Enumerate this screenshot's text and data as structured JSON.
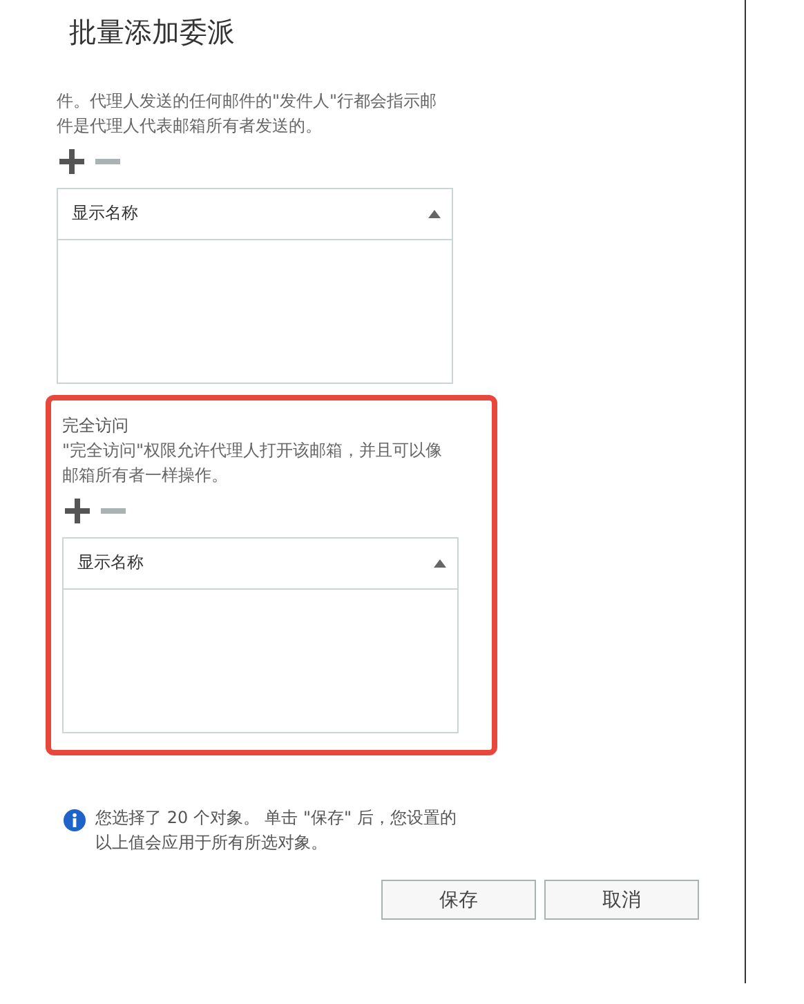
{
  "window": {
    "title": "批量添加委派"
  },
  "sections": [
    {
      "highlighted": false,
      "description": "件。代理人发送的任何邮件的\"发件人\"行都会指示邮件是代理人代表邮箱所有者发送的。",
      "tools": [
        {
          "kind": "add",
          "disabled": false
        },
        {
          "kind": "remove",
          "disabled": true
        }
      ],
      "table": {
        "columns": [
          "显示名称"
        ]
      }
    },
    {
      "highlighted": true,
      "label": "完全访问",
      "description": "\"完全访问\"权限允许代理人打开该邮箱，并且可以像邮箱所有者一样操作。",
      "tools": [
        {
          "kind": "add",
          "disabled": false
        },
        {
          "kind": "remove",
          "disabled": true
        }
      ],
      "table": {
        "columns": [
          "显示名称"
        ]
      }
    }
  ],
  "info": "您选择了 20 个对象。 单击 \"保存\" 后，您设置的以上值会应用于所有所选对象。",
  "buttons": [
    "保存",
    "取消"
  ]
}
